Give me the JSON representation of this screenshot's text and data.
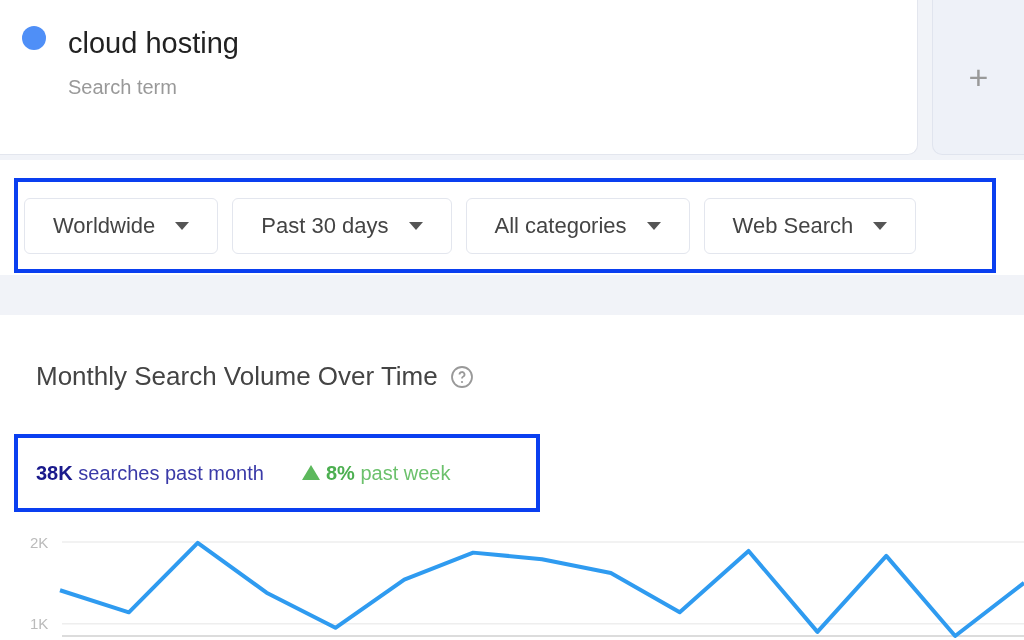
{
  "term": {
    "label": "cloud hosting",
    "sublabel": "Search term",
    "color": "#4f8ff7"
  },
  "add_button": {
    "label": "+"
  },
  "filters": [
    {
      "label": "Worldwide"
    },
    {
      "label": "Past 30 days"
    },
    {
      "label": "All categories"
    },
    {
      "label": "Web Search"
    }
  ],
  "section": {
    "title": "Monthly Search Volume Over Time",
    "summary": {
      "count": "38K",
      "count_text": "searches past month",
      "change": "8%",
      "change_text": "past week"
    },
    "chart_data": {
      "type": "line",
      "ylim": [
        850,
        2000
      ],
      "yticks": [
        {
          "value": 1000,
          "label": "1K"
        },
        {
          "value": 2000,
          "label": "2K"
        }
      ],
      "values": [
        1410,
        1140,
        1990,
        1380,
        950,
        1540,
        1870,
        1790,
        1620,
        1140,
        1890,
        900,
        1830,
        850,
        1500
      ]
    }
  }
}
